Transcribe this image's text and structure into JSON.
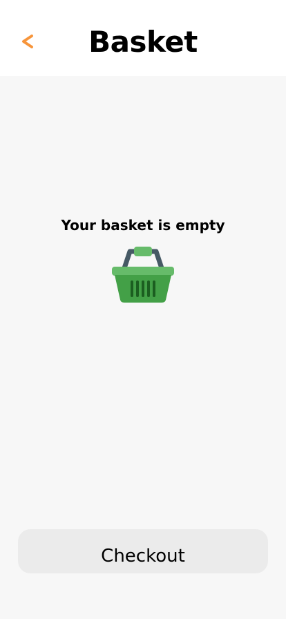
{
  "header": {
    "back_icon": "chevron-left-icon",
    "back_color": "#f7953b",
    "title": "Basket"
  },
  "main": {
    "empty_message": "Your basket is empty",
    "basket_icon": "shopping-basket-icon",
    "basket_colors": {
      "handle": "#465a65",
      "rim": "#66bb6a",
      "body": "#43a047",
      "slots": "#1b5e20"
    }
  },
  "footer": {
    "checkout_label": "Checkout"
  }
}
